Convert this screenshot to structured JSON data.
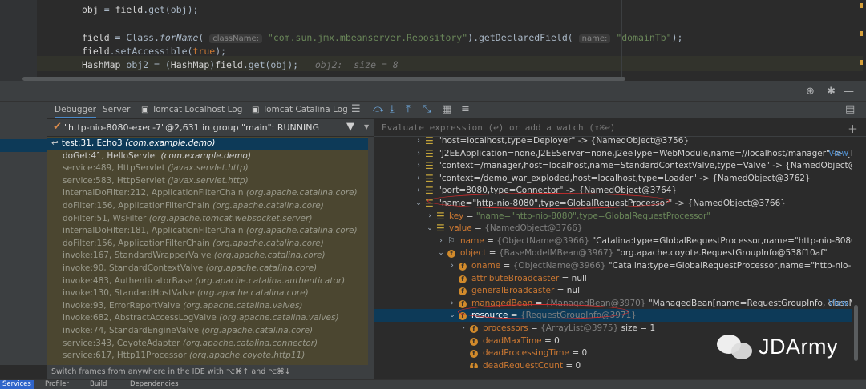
{
  "editor": {
    "lines": [
      {
        "id": "l1",
        "parts": [
          [
            "obj",
            "fld"
          ],
          [
            " = ",
            ""
          ],
          [
            "field",
            "fld"
          ],
          [
            ".get(obj);",
            ""
          ]
        ]
      },
      {
        "id": "l2",
        "parts": [
          [
            "field",
            "fld"
          ],
          [
            " = Class.",
            ""
          ],
          [
            "forName",
            "it"
          ],
          [
            "( ",
            ""
          ],
          [
            "className:",
            "hint"
          ],
          [
            " ",
            ""
          ],
          [
            "\"com.sun.jmx.mbeanserver.Repository\"",
            "str"
          ],
          [
            ").getDeclaredField( ",
            ""
          ],
          [
            "name:",
            "hint"
          ],
          [
            " ",
            ""
          ],
          [
            "\"domainTb\"",
            "str"
          ],
          [
            ");",
            ""
          ]
        ]
      },
      {
        "id": "l3",
        "parts": [
          [
            "field",
            "fld"
          ],
          [
            ".setAccessible(",
            ""
          ],
          [
            "true",
            "kw"
          ],
          [
            ");",
            ""
          ]
        ]
      },
      {
        "id": "l4",
        "parts": [
          [
            "HashMap",
            "fld"
          ],
          [
            " obj2 = (",
            ""
          ],
          [
            "HashMap",
            "fld"
          ],
          [
            ")",
            ""
          ],
          [
            "field",
            "fld"
          ],
          [
            ".get(obj);",
            ""
          ],
          [
            "   obj2:  size = 8",
            "inl"
          ]
        ]
      }
    ]
  },
  "toolbar": {
    "tabs": [
      {
        "label": "Debugger",
        "active": true
      },
      {
        "label": "Server",
        "active": false
      },
      {
        "label": "Tomcat Localhost Log",
        "active": false
      },
      {
        "label": "Tomcat Catalina Log",
        "active": false
      }
    ]
  },
  "thread": {
    "label": "\"http-nio-8080-exec-7\"@2,631 in group \"main\": RUNNING"
  },
  "frames": [
    {
      "method": "test:31, Echo3",
      "pkg": "(com.example.demo)",
      "selected": true
    },
    {
      "method": "doGet:41, HelloServlet",
      "pkg": "(com.example.demo)",
      "strong": true
    },
    {
      "method": "service:489, HttpServlet",
      "pkg": "(javax.servlet.http)"
    },
    {
      "method": "service:583, HttpServlet",
      "pkg": "(javax.servlet.http)"
    },
    {
      "method": "internalDoFilter:212, ApplicationFilterChain",
      "pkg": "(org.apache.catalina.core)"
    },
    {
      "method": "doFilter:156, ApplicationFilterChain",
      "pkg": "(org.apache.catalina.core)"
    },
    {
      "method": "doFilter:51, WsFilter",
      "pkg": "(org.apache.tomcat.websocket.server)"
    },
    {
      "method": "internalDoFilter:181, ApplicationFilterChain",
      "pkg": "(org.apache.catalina.core)"
    },
    {
      "method": "doFilter:156, ApplicationFilterChain",
      "pkg": "(org.apache.catalina.core)"
    },
    {
      "method": "invoke:167, StandardWrapperValve",
      "pkg": "(org.apache.catalina.core)"
    },
    {
      "method": "invoke:90, StandardContextValve",
      "pkg": "(org.apache.catalina.core)"
    },
    {
      "method": "invoke:483, AuthenticatorBase",
      "pkg": "(org.apache.catalina.authenticator)"
    },
    {
      "method": "invoke:130, StandardHostValve",
      "pkg": "(org.apache.catalina.core)"
    },
    {
      "method": "invoke:93, ErrorReportValve",
      "pkg": "(org.apache.catalina.valves)"
    },
    {
      "method": "invoke:682, AbstractAccessLogValve",
      "pkg": "(org.apache.catalina.valves)"
    },
    {
      "method": "invoke:74, StandardEngineValve",
      "pkg": "(org.apache.catalina.core)"
    },
    {
      "method": "service:343, CoyoteAdapter",
      "pkg": "(org.apache.catalina.connector)"
    },
    {
      "method": "service:617, Http11Processor",
      "pkg": "(org.apache.coyote.http11)"
    }
  ],
  "frames_footer": "Switch frames from anywhere in the IDE with ⌥⌘↑ and ⌥⌘↓",
  "evaluate_placeholder": "Evaluate expression (↩) or add a watch (⇧⌘↩)",
  "variables": [
    {
      "indent": 0,
      "tw": "›",
      "icon": "entry",
      "segs": [
        [
          "\"host=localhost,type=Deployer\" -> {NamedObject@3756}",
          "plain"
        ]
      ]
    },
    {
      "indent": 0,
      "tw": "›",
      "icon": "entry",
      "segs": [
        [
          "\"J2EEApplication=none,J2EEServer=none,j2eeType=WebModule,name=//localhost/manager\" -> {Nar…",
          "plain"
        ]
      ],
      "link": "View"
    },
    {
      "indent": 0,
      "tw": "›",
      "icon": "entry",
      "segs": [
        [
          "\"context=/manager,host=localhost,name=StandardContextValve,type=Valve\" -> {NamedObject@3760}",
          "plain"
        ]
      ]
    },
    {
      "indent": 0,
      "tw": "›",
      "icon": "entry",
      "segs": [
        [
          "\"context=/demo_war_exploded,host=localhost,type=Loader\" -> {NamedObject@3762}",
          "plain"
        ]
      ]
    },
    {
      "indent": 0,
      "tw": "›",
      "icon": "entry",
      "segs": [
        [
          "\"port=8080,type=Connector\" -> {NamedObject@3764}",
          "plain"
        ]
      ]
    },
    {
      "indent": 0,
      "tw": "⌄",
      "icon": "entry",
      "segs": [
        [
          "\"name=\"http-nio-8080\",type=GlobalRequestProcessor\" -> {NamedObject@3766}",
          "plain"
        ]
      ]
    },
    {
      "indent": 1,
      "tw": "›",
      "icon": "entry",
      "segs": [
        [
          "key",
          "name"
        ],
        [
          " = ",
          "plain"
        ],
        [
          "\"name=\"http-nio-8080\",type=GlobalRequestProcessor\"",
          "str"
        ]
      ]
    },
    {
      "indent": 1,
      "tw": "⌄",
      "icon": "entry",
      "segs": [
        [
          "value",
          "name"
        ],
        [
          " = ",
          "plain"
        ],
        [
          "{NamedObject@3766}",
          "type"
        ]
      ]
    },
    {
      "indent": 2,
      "tw": "›",
      "icon": "flag",
      "segs": [
        [
          "name",
          "name"
        ],
        [
          " = ",
          "plain"
        ],
        [
          "{ObjectName@3966} ",
          "type"
        ],
        [
          "\"Catalina:type=GlobalRequestProcessor,name=\"http-nio-8080\"\"",
          "plain"
        ]
      ]
    },
    {
      "indent": 2,
      "tw": "⌄",
      "icon": "field",
      "segs": [
        [
          "object",
          "name"
        ],
        [
          " = ",
          "plain"
        ],
        [
          "{BaseModelMBean@3967} ",
          "type"
        ],
        [
          "\"org.apache.coyote.RequestGroupInfo@538f10af\"",
          "plain"
        ]
      ]
    },
    {
      "indent": 3,
      "tw": "›",
      "icon": "field",
      "segs": [
        [
          "oname",
          "name"
        ],
        [
          " = ",
          "plain"
        ],
        [
          "{ObjectName@3966} ",
          "type"
        ],
        [
          "\"Catalina:type=GlobalRequestProcessor,name=\"http-nio-8080\"\"",
          "plain"
        ]
      ]
    },
    {
      "indent": 3,
      "tw": "",
      "icon": "field",
      "segs": [
        [
          "attributeBroadcaster",
          "name"
        ],
        [
          " = null",
          "plain"
        ]
      ]
    },
    {
      "indent": 3,
      "tw": "",
      "icon": "field",
      "segs": [
        [
          "generalBroadcaster",
          "name"
        ],
        [
          " = null",
          "plain"
        ]
      ]
    },
    {
      "indent": 3,
      "tw": "›",
      "icon": "field",
      "segs": [
        [
          "managedBean",
          "name"
        ],
        [
          " = ",
          "plain"
        ],
        [
          "{ManagedBean@3970} ",
          "type"
        ],
        [
          "\"ManagedBean[name=RequestGroupInfo, className…",
          "plain"
        ]
      ],
      "link": "View"
    },
    {
      "indent": 3,
      "tw": "⌄",
      "icon": "field",
      "selected": true,
      "segs": [
        [
          "resource",
          "namew"
        ],
        [
          " = ",
          "plain"
        ],
        [
          "{RequestGroupInfo@3971}",
          "type"
        ]
      ]
    },
    {
      "indent": 4,
      "tw": "›",
      "icon": "field",
      "segs": [
        [
          "processors",
          "name"
        ],
        [
          " = ",
          "plain"
        ],
        [
          "{ArrayList@3975} ",
          "type"
        ],
        [
          " size = 1",
          "plain"
        ]
      ]
    },
    {
      "indent": 4,
      "tw": "",
      "icon": "field",
      "segs": [
        [
          "deadMaxTime",
          "name"
        ],
        [
          " = 0",
          "plain"
        ]
      ]
    },
    {
      "indent": 4,
      "tw": "",
      "icon": "field",
      "segs": [
        [
          "deadProcessingTime",
          "name"
        ],
        [
          " = 0",
          "plain"
        ]
      ]
    },
    {
      "indent": 4,
      "tw": "",
      "icon": "field",
      "segs": [
        [
          "deadRequestCount",
          "name"
        ],
        [
          " = 0",
          "plain"
        ]
      ]
    }
  ],
  "status": {
    "items": [
      "Services",
      "Profiler",
      "Build",
      "Dependencies"
    ]
  },
  "watermark": {
    "text": "JDArmy"
  },
  "colors": {
    "accent": "#4a88c7",
    "selection": "#0d3a58",
    "frames_bg": "#4b4630",
    "annotation": "#d22c2c"
  }
}
